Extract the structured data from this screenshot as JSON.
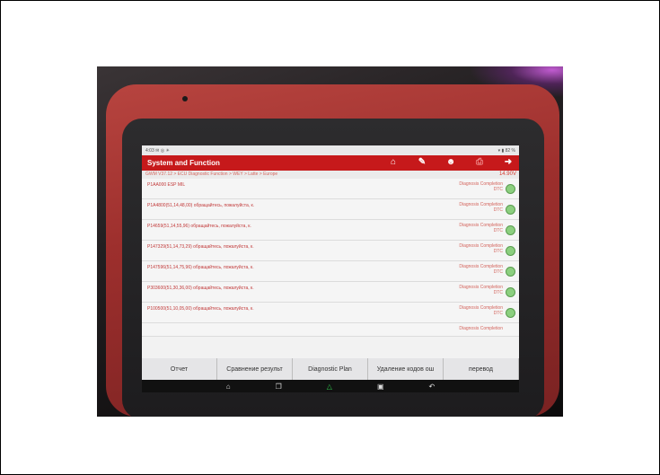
{
  "app": {
    "title": "System and Function",
    "status_left": "4:03  ✉ ◎ ☀",
    "status_right": "▾ ▮ 82 %",
    "breadcrumb": "GWM V37.12 > ECU Diagnostic Function > WEY > Latte > Europe",
    "voltage": "14.90V"
  },
  "rows": [
    {
      "code": "P1AA000 ESP MIL",
      "status": "Diagnosis Completion\nDTC"
    },
    {
      "code": "P1A4800(51,14,48,00) обращайтесь, пожалуйста, к.",
      "status": "Diagnosis Completion\nDTC"
    },
    {
      "code": "P14659(51,14,55,96) обращайтесь, пожалуйста, к.",
      "status": "Diagnosis Completion\nDTC"
    },
    {
      "code": "P147329(51,14,73,29) обращайтесь, пожалуйста, к.",
      "status": "Diagnosis Completion\nDTC"
    },
    {
      "code": "P147596(51,14,75,96) обращайтесь, пожалуйста, к.",
      "status": "Diagnosis Completion\nDTC"
    },
    {
      "code": "P303600(51,30,36,00) обращайтесь, пожалуйста, к.",
      "status": "Diagnosis Completion\nDTC"
    },
    {
      "code": "P100500(51,10,05,00) обращайтесь, пожалуйста, к.",
      "status": "Diagnosis Completion\nDTC"
    },
    {
      "code": "",
      "status": "Diagnosis Completion"
    }
  ],
  "buttons": [
    "Отчет",
    "Сравнение результ",
    "Diagnostic Plan",
    "Удаление кодов ош",
    "перевод"
  ],
  "icons": {
    "home": "home-icon",
    "edit": "edit-icon",
    "user": "user-icon",
    "print": "print-icon",
    "exit": "exit-icon"
  }
}
